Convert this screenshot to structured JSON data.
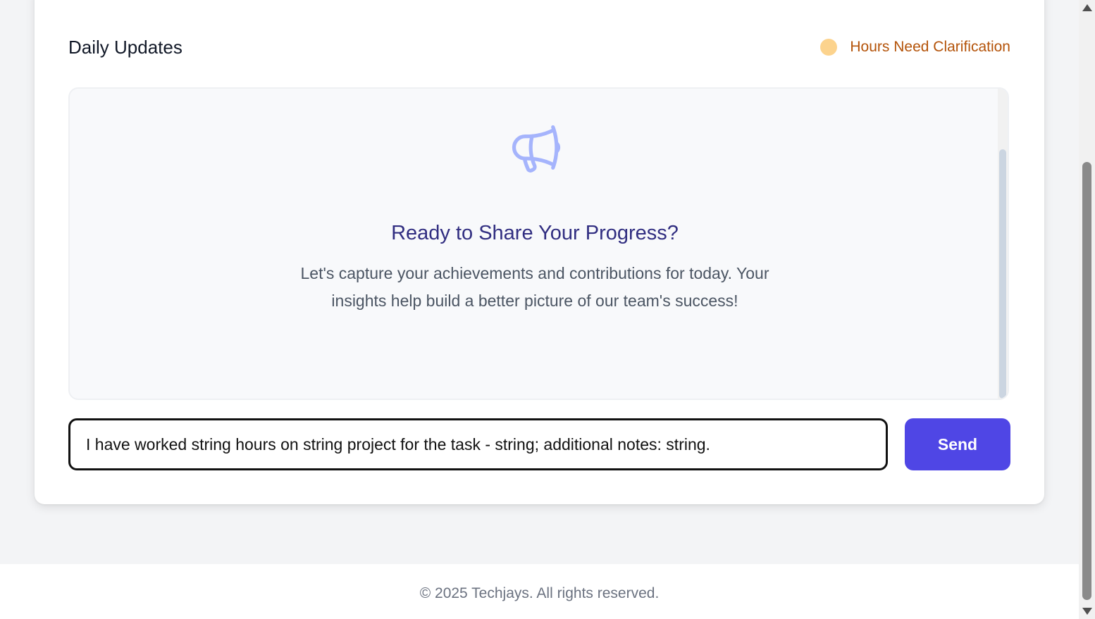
{
  "header": {
    "title": "Daily Updates",
    "status_label": "Hours Need Clarification",
    "status_color": "#fcd38d",
    "status_text_color": "#b45309"
  },
  "empty_state": {
    "icon": "megaphone-icon",
    "title": "Ready to Share Your Progress?",
    "description": "Let's capture your achievements and contributions for today. Your insights help build a better picture of our team's success!"
  },
  "composer": {
    "input_value": "I have worked string hours on string project for the task - string; additional notes: string.",
    "send_label": "Send",
    "accent_color": "#4f46e5"
  },
  "footer": {
    "text": "© 2025 Techjays. All rights reserved."
  }
}
